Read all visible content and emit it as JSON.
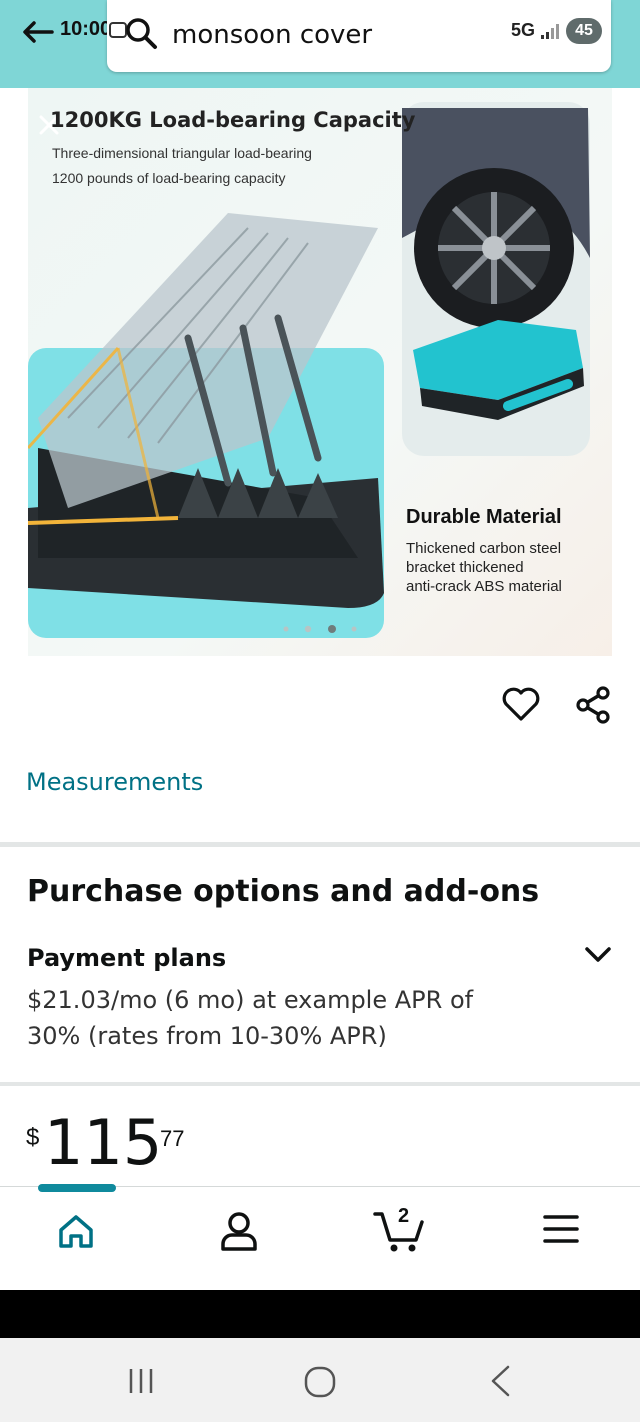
{
  "status_bar": {
    "time": "10:00",
    "network": "5G",
    "battery": "45"
  },
  "search": {
    "query": "monsoon cover"
  },
  "product_image": {
    "headline": "1200KG Load-bearing Capacity",
    "sub1": "Three-dimensional triangular load-bearing",
    "sub2": "1200 pounds of load-bearing capacity",
    "title2": "Durable Material",
    "desc1": "Thickened carbon steel",
    "desc2": "bracket thickened",
    "desc3": "anti-crack ABS material",
    "carousel_dot_count": 4,
    "active_dot": 3
  },
  "links": {
    "measurements": "Measurements"
  },
  "purchase": {
    "section_title": "Purchase options and add-ons",
    "payment_title": "Payment plans",
    "payment_line1": "$21.03/mo (6 mo) at example APR of",
    "payment_line2": "30% (rates from 10-30% APR)"
  },
  "price": {
    "symbol": "$",
    "whole": "115",
    "fraction": "77"
  },
  "bottom_nav": {
    "cart_count": "2",
    "items": [
      "home-icon",
      "account-icon",
      "cart-icon",
      "menu-icon"
    ]
  },
  "colors": {
    "accent_teal": "#007185",
    "topbar": "#7fd6d6",
    "active_indicator": "#0f8a9d"
  }
}
